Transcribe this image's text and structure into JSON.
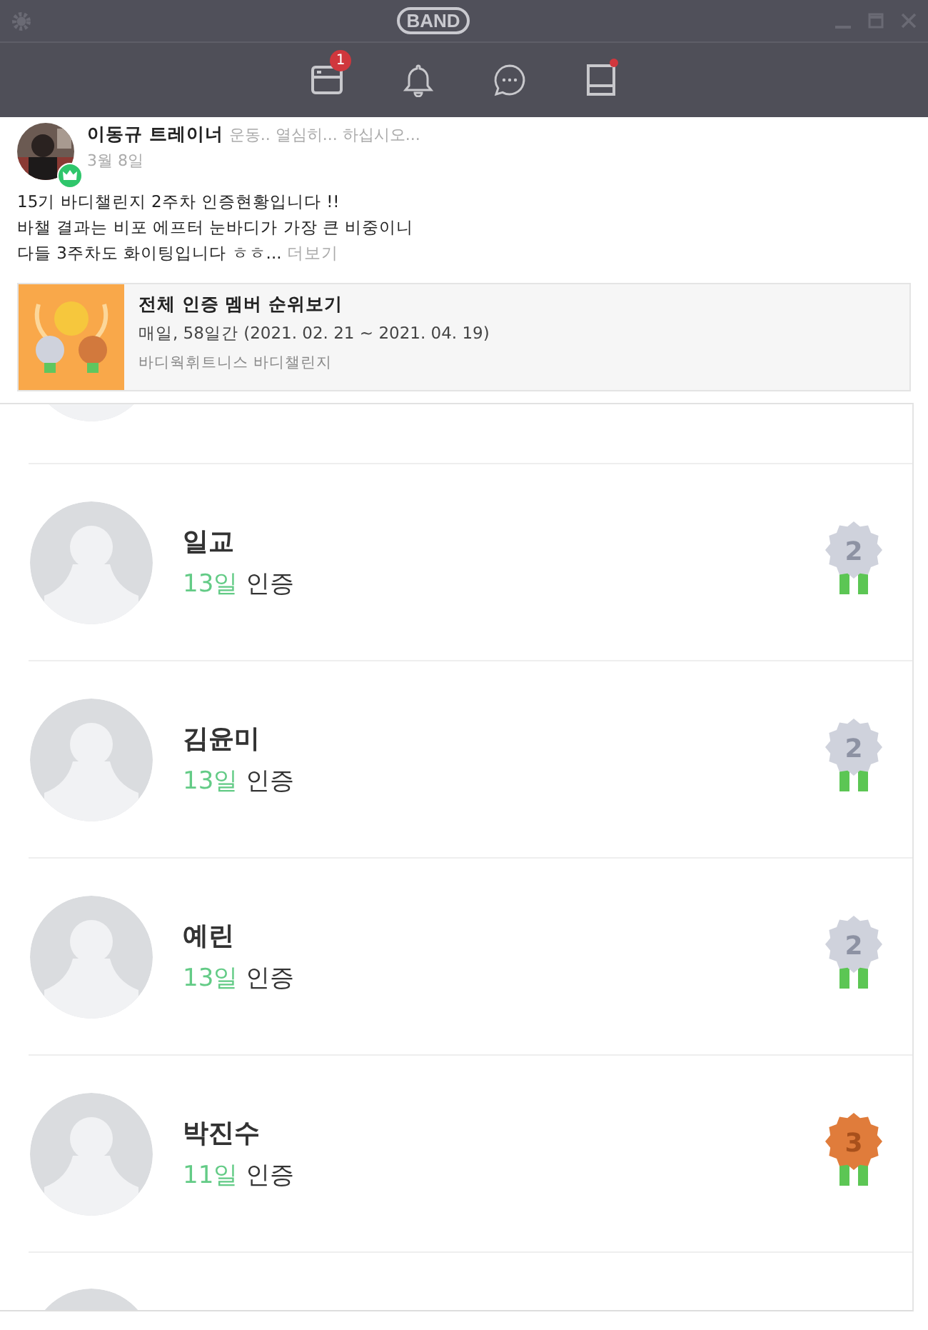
{
  "window": {
    "logo": "BAND"
  },
  "nav": {
    "tabs": [
      {
        "kind": "feed",
        "badge": "1",
        "dot": false
      },
      {
        "kind": "bell",
        "dot": false
      },
      {
        "kind": "chat",
        "dot": false
      },
      {
        "kind": "page",
        "dot": true
      }
    ]
  },
  "post": {
    "author": "이동규 트레이너",
    "status": "운동.. 열심히... 하십시오...",
    "date": "3월 8일",
    "lines": [
      "15기 바디챌린지 2주차 인증현황입니다 !!",
      "바챌 결과는 비포 에프터 눈바디가 가장 큰 비중이니",
      "다들 3주차도 화이팅입니다 ㅎㅎ..."
    ],
    "more": "더보기"
  },
  "card": {
    "title": "전체 인증 멤버 순위보기",
    "period": "매일, 58일간 (2021. 02. 21 ~ 2021. 04. 19)",
    "band": "바디웍휘트니스 바디챌린지"
  },
  "ranking": [
    {
      "name": "일교",
      "days": "13일",
      "suffix": "인증",
      "rank": "2"
    },
    {
      "name": "김윤미",
      "days": "13일",
      "suffix": "인증",
      "rank": "2"
    },
    {
      "name": "예린",
      "days": "13일",
      "suffix": "인증",
      "rank": "2"
    },
    {
      "name": "박진수",
      "days": "11일",
      "suffix": "인증",
      "rank": "3"
    }
  ]
}
